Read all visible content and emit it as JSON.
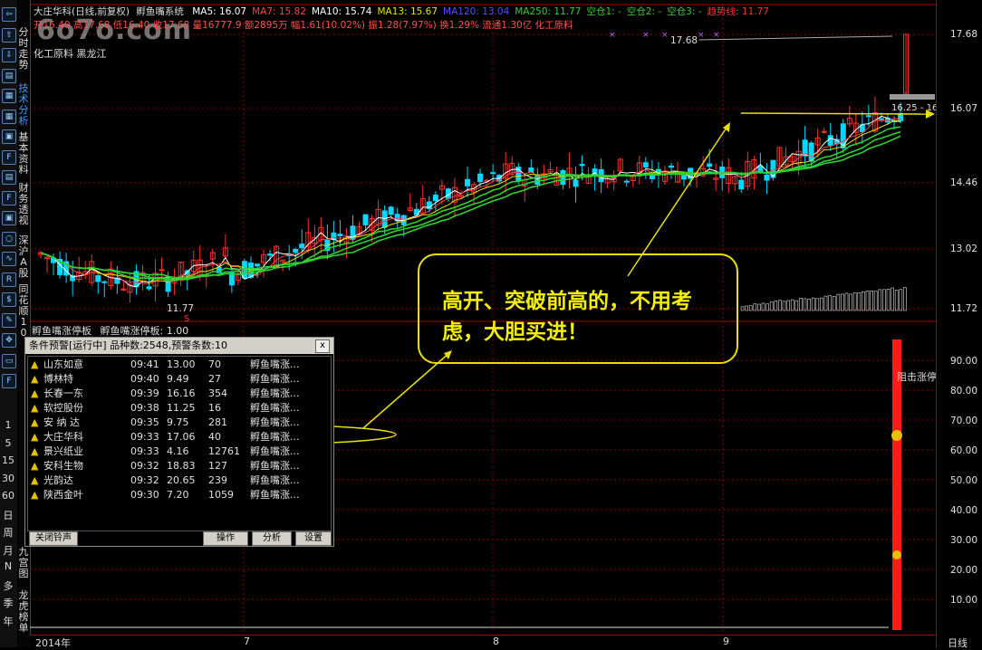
{
  "watermark": "6o7o.com",
  "header": {
    "stock": "大庄华科(日线,前复权)",
    "formula": "孵鱼嘴系统",
    "ma": [
      {
        "label": "MA5: 16.07",
        "color": "#ffffff"
      },
      {
        "label": "MA7: 15.82",
        "color": "#ff4040"
      },
      {
        "label": "MA10: 15.74",
        "color": "#ffffff"
      },
      {
        "label": "MA13: 15.67",
        "color": "#e8e000"
      },
      {
        "label": "MA120: 13.04",
        "color": "#5050ff"
      },
      {
        "label": "MA250: 11.77",
        "color": "#30d030"
      },
      {
        "label": "空仓1: -",
        "color": "#30d030"
      },
      {
        "label": "空仓2: -",
        "color": "#30d030"
      },
      {
        "label": "空仓3: -",
        "color": "#30d030"
      },
      {
        "label": "趋势线: 11.77",
        "color": "#ff3030"
      }
    ],
    "line2": "开16.40 高17.68 低16.40 收17.68 量16777.9 额2895万 幅1.61(10.02%) 振1.28(7.97%) 换1.29% 流通1.30亿 化工原料",
    "industry": "化工原料 黑龙江",
    "subpanel_label": "孵鱼嘴涨停板",
    "subpanel_value": "孵鱼嘴涨停板: 1.00"
  },
  "sidebar": {
    "tabs": [
      "分时走势",
      "技术分析",
      "基本资料",
      "财务透视",
      "深沪A股",
      "同花顺10",
      "九宫图",
      "龙虎榜单"
    ],
    "periods": [
      "1",
      "5",
      "15",
      "30",
      "60",
      "日",
      "周",
      "月",
      "N",
      "多",
      "季",
      "年"
    ]
  },
  "price_axis": [
    "17.68",
    "16.07",
    "14.46",
    "13.02",
    "11.72"
  ],
  "indicator_axis": [
    "90.00",
    "80.00",
    "70.00",
    "60.00",
    "50.00",
    "40.00",
    "30.00",
    "20.00",
    "10.00"
  ],
  "indicator_label": "阻击涨停",
  "price_marks": {
    "high": "17.68",
    "low": "11.77",
    "range": "16.25 - 16"
  },
  "x_axis": {
    "labels": [
      "2014年",
      "7",
      "8",
      "9"
    ],
    "period": "日线"
  },
  "callout": {
    "text": "高开、突破前高的，不用考虑，大胆买进！"
  },
  "alert_window": {
    "title": "条件预警[运行中] 品种数:2548,预警条数:10",
    "close": "x",
    "rows": [
      {
        "name": "山东如意",
        "time": "09:41",
        "price": "13.00",
        "vol": "70",
        "cond": "孵鱼嘴涨..."
      },
      {
        "name": "博林特",
        "time": "09:40",
        "price": "9.49",
        "vol": "27",
        "cond": "孵鱼嘴涨..."
      },
      {
        "name": "长春一东",
        "time": "09:39",
        "price": "16.16",
        "vol": "354",
        "cond": "孵鱼嘴涨..."
      },
      {
        "name": "软控股份",
        "time": "09:38",
        "price": "11.25",
        "vol": "16",
        "cond": "孵鱼嘴涨..."
      },
      {
        "name": "安 纳 达",
        "time": "09:35",
        "price": "9.75",
        "vol": "281",
        "cond": "孵鱼嘴涨..."
      },
      {
        "name": "大庄华科",
        "time": "09:33",
        "price": "17.06",
        "vol": "40",
        "cond": "孵鱼嘴涨..."
      },
      {
        "name": "景兴纸业",
        "time": "09:33",
        "price": "4.16",
        "vol": "12761",
        "cond": "孵鱼嘴涨..."
      },
      {
        "name": "安科生物",
        "time": "09:32",
        "price": "18.83",
        "vol": "127",
        "cond": "孵鱼嘴涨..."
      },
      {
        "name": "光韵达",
        "time": "09:32",
        "price": "20.65",
        "vol": "239",
        "cond": "孵鱼嘴涨..."
      },
      {
        "name": "陕西金叶",
        "time": "09:30",
        "price": "7.20",
        "vol": "1059",
        "cond": "孵鱼嘴涨..."
      }
    ],
    "buttons": {
      "close_all": "关闭铃声",
      "operate": "操作",
      "analyze": "分析",
      "settings": "设置"
    }
  },
  "colors": {
    "up": "#ff3030",
    "down": "#00d8ff",
    "accent": "#e8e000",
    "grid": "#8b0000"
  }
}
